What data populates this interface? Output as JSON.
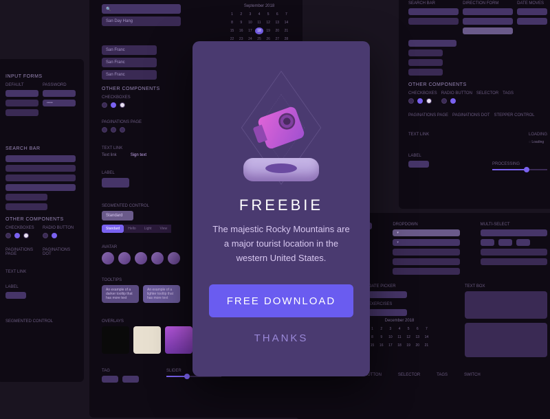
{
  "modal": {
    "title": "FREEBIE",
    "desc": "The majestic Rocky Mountains are a major tourist location in the western United States.",
    "button": "FREE DOWNLOAD",
    "thanks": "THANKS"
  },
  "p1": {
    "input_forms": "INPUT FORMS",
    "default": "DEFAULT",
    "password": "PASSWORD",
    "search_bar": "SEARCH BAR",
    "direction_form": "DIRECTION FORM",
    "other_components": "OTHER COMPONENTS",
    "checkboxes": "CHECKBOXES",
    "radio_button": "RADIO BUTTON",
    "paginations_page": "PAGINATIONS PAGE",
    "paginations_dot": "PAGINATIONS DOT",
    "text_link": "TEXT LINK",
    "label": "LABEL",
    "segmented_control": "SEGMENTED CONTROL"
  },
  "p2": {
    "other_components": "OTHER COMPONENTS",
    "checkboxes": "CHECKBOXES",
    "radio_button": "RADIO BUTTON",
    "paginations_page": "PAGINATIONS PAGE",
    "paginations_dot": "PAGINATIONS DOT",
    "text_link": "TEXT LINK",
    "text_link_text": "Text link",
    "sign_text": "Sign text",
    "label": "LABEL",
    "segmented_control": "SEGMENTED CONTROL",
    "seg1": "Standard",
    "seg2": "Hello",
    "seg3": "Light",
    "seg4": "View",
    "avatar": "AVATAR",
    "tooltips": "TOOLTIPS",
    "tooltip1": "An example of a darker tooltip that has more text",
    "tooltip2": "An example of a lighter tooltip that has more text",
    "overlays": "OVERLAYS",
    "tag": "TAG",
    "slider": "SLIDER"
  },
  "cal": {
    "month": "September 2018"
  },
  "p3": {
    "search_bar": "SEARCH BAR",
    "direction_form": "DIRECTION FORM",
    "date_moves": "DATE MOVES",
    "other_components": "OTHER COMPONENTS",
    "checkboxes": "CHECKBOXES",
    "radio_button": "RADIO BUTTON",
    "selector": "SELECTOR",
    "tags": "TAGS",
    "paginations_page": "PAGINATIONS PAGE",
    "paginations_dot": "PAGINATIONS DOT",
    "stepper_control": "STEPPER CONTROL",
    "text_link": "TEXT LINK",
    "loading": "LOADING",
    "loading_text": "Loading",
    "label": "LABEL",
    "processing": "PROCESSING"
  },
  "p4": {
    "dropdown": "DROPDOWN",
    "multi_select": "MULTI-SELECT",
    "date_picker": "DATE PICKER",
    "text_box": "TEXT BOX",
    "exercises": "EXERCISES",
    "cal_month": "December 2018",
    "other_components": "OTHER COMPONENTS",
    "checkboxes": "CHECKBOXES",
    "radio_button": "RADIO BUTTON",
    "selector": "SELECTOR",
    "tags": "TAGS",
    "switch": "SWITCH"
  }
}
